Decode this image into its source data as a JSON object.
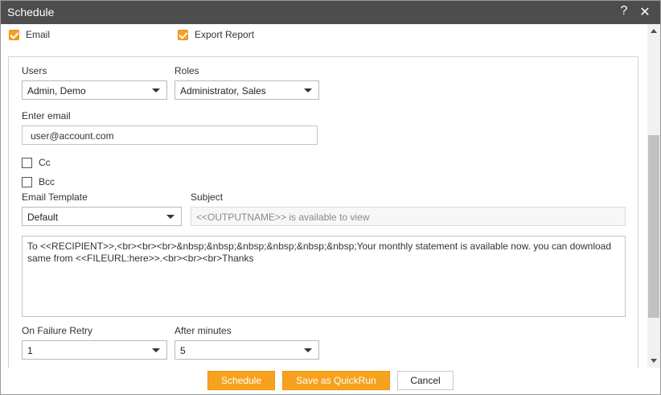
{
  "window": {
    "title": "Schedule",
    "help_glyph": "?",
    "close_glyph": "✕"
  },
  "top_checks": {
    "email": {
      "label": "Email",
      "checked": true
    },
    "export_report": {
      "label": "Export Report",
      "checked": true
    }
  },
  "users": {
    "label": "Users",
    "value": "Admin, Demo"
  },
  "roles": {
    "label": "Roles",
    "value": "Administrator, Sales"
  },
  "email": {
    "label": "Enter email",
    "value": "user@account.com"
  },
  "cc": {
    "label": "Cc",
    "checked": false
  },
  "bcc": {
    "label": "Bcc",
    "checked": false
  },
  "template": {
    "label": "Email Template",
    "value": "Default"
  },
  "subject": {
    "label": "Subject",
    "value": "<<OUTPUTNAME>> is available to view"
  },
  "body_text": "To <<RECIPIENT>>,<br><br><br>&nbsp;&nbsp;&nbsp;&nbsp;&nbsp;&nbsp;Your monthly statement is available now. you can download same from <<FILEURL:here>>.<br><br><br>Thanks",
  "retry": {
    "label": "On Failure Retry",
    "value": "1"
  },
  "after_minutes": {
    "label": "After minutes",
    "value": "5"
  },
  "buttons": {
    "schedule": "Schedule",
    "save_quickrun": "Save as QuickRun",
    "cancel": "Cancel"
  },
  "colors": {
    "accent": "#f7a21d",
    "titlebar": "#4d4d4d"
  }
}
